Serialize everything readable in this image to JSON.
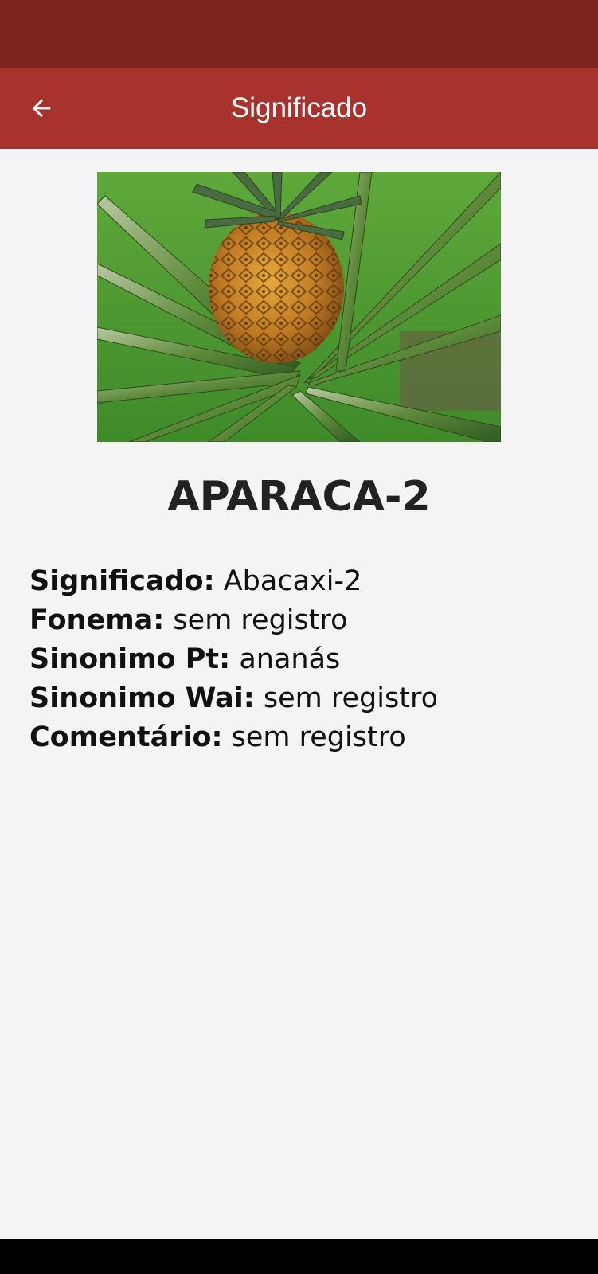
{
  "app_bar": {
    "title": "Significado",
    "back_icon": "arrow-left-icon"
  },
  "image": {
    "subject": "pineapple-photo"
  },
  "word": "APARACA-2",
  "details": [
    {
      "label": "Significado:",
      "value": "Abacaxi-2"
    },
    {
      "label": "Fonema:",
      "value": "sem registro"
    },
    {
      "label": "Sinonimo Pt:",
      "value": "ananás"
    },
    {
      "label": "Sinonimo Wai:",
      "value": "sem registro"
    },
    {
      "label": "Comentário:",
      "value": "sem registro"
    }
  ],
  "colors": {
    "status_bar": "#7b2420",
    "app_bar": "#a8322c",
    "background": "#f4f4f4",
    "title_text": "#222222"
  }
}
